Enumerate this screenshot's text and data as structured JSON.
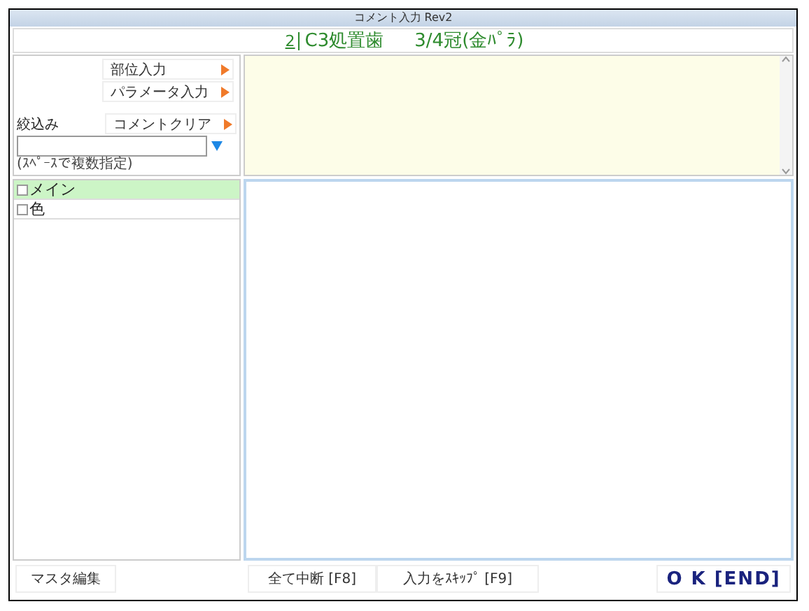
{
  "window": {
    "title": "コメント入力 Rev2"
  },
  "header": {
    "number": "2",
    "treatment": "C3処置歯",
    "crown": "3/4冠(金ﾊﾟﾗ)"
  },
  "side_buttons": [
    {
      "label": "部位入力"
    },
    {
      "label": "パラメータ入力"
    },
    {
      "label": "コメントクリア"
    }
  ],
  "filter": {
    "label": "絞込み",
    "hint": "(ｽﾍﾟｰｽで複数指定)"
  },
  "list": [
    {
      "label": "メイン",
      "checked": false,
      "selected": true
    },
    {
      "label": "色",
      "checked": false,
      "selected": false
    }
  ],
  "footer": {
    "master_button": "マスタ編集",
    "stop_button": "全て中断 [F8]",
    "skip_button": "入力をｽｷｯﾌﾟ [F9]",
    "ok_button": "O K [END]"
  }
}
